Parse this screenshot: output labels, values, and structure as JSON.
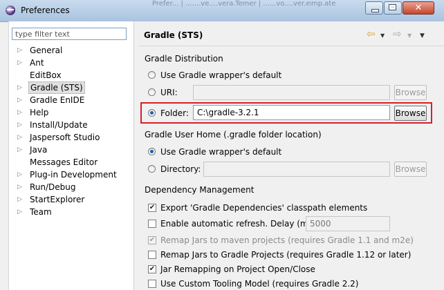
{
  "window": {
    "title": "Preferences",
    "background_tabs": [
      "Prefer...  |    .......ve....vera...   ",
      "Temer  |   ......vo....ver.er......",
      "mp.ate"
    ]
  },
  "filter": {
    "placeholder": "type filter text"
  },
  "tree": {
    "items": [
      {
        "label": "General",
        "expandable": true
      },
      {
        "label": "Ant",
        "expandable": true
      },
      {
        "label": "EditBox",
        "expandable": false
      },
      {
        "label": "Gradle (STS)",
        "expandable": true,
        "selected": true
      },
      {
        "label": "Gradle EnIDE",
        "expandable": true
      },
      {
        "label": "Help",
        "expandable": true
      },
      {
        "label": "Install/Update",
        "expandable": true
      },
      {
        "label": "Jaspersoft Studio",
        "expandable": true
      },
      {
        "label": "Java",
        "expandable": true
      },
      {
        "label": "Messages Editor",
        "expandable": false
      },
      {
        "label": "Plug-in Development",
        "expandable": true
      },
      {
        "label": "Run/Debug",
        "expandable": true
      },
      {
        "label": "StartExplorer",
        "expandable": true
      },
      {
        "label": "Team",
        "expandable": true
      }
    ]
  },
  "page": {
    "title": "Gradle (STS)",
    "nav_icons": [
      "back-arrow-icon",
      "dropdown-icon",
      "forward-arrow-icon",
      "dropdown-icon",
      "view-menu-icon"
    ]
  },
  "distribution": {
    "heading": "Gradle Distribution",
    "wrapper_label": "Use Gradle wrapper's default",
    "uri_label": "URI:",
    "uri_value": "",
    "folder_label": "Folder:",
    "folder_value": "C:\\gradle-3.2.1",
    "browse_label": "Browse",
    "selected": "folder"
  },
  "user_home": {
    "heading": "Gradle User Home (.gradle folder location)",
    "wrapper_label": "Use Gradle wrapper's default",
    "directory_label": "Directory:",
    "directory_value": "",
    "browse_label": "Browse",
    "selected": "wrapper"
  },
  "dependency": {
    "heading": "Dependency Management",
    "export_label": "Export 'Gradle Dependencies' classpath elements",
    "export_checked": true,
    "refresh_label": "Enable automatic refresh. Delay (ms) :",
    "refresh_checked": false,
    "refresh_delay": "5000",
    "remap_maven_label": "Remap Jars to maven projects (requires Gradle 1.1 and m2e)",
    "remap_maven_checked": true,
    "remap_maven_disabled": true,
    "remap_gradle_label": "Remap Jars to Gradle Projects (requires Gradle 1.12 or later)",
    "remap_gradle_checked": false,
    "jar_remap_label": "Jar Remapping on Project Open/Close",
    "jar_remap_checked": true,
    "tooling_label": "Use Custom Tooling Model (requires Gradle 2.2)",
    "tooling_checked": false
  },
  "colors": {
    "highlight": "#d61f26",
    "selection": "#e0e0e0",
    "radio_dot": "#1f5fb0"
  }
}
